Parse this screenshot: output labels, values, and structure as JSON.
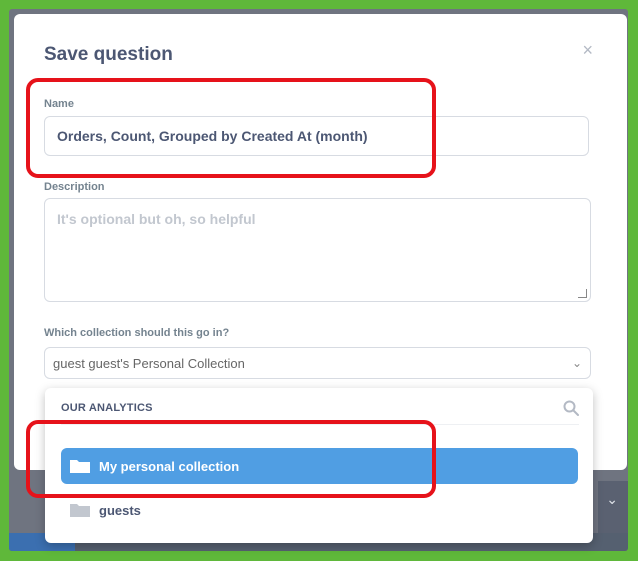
{
  "dialog": {
    "title": "Save question",
    "close_label": "×"
  },
  "name_field": {
    "label": "Name",
    "value": "Orders, Count, Grouped by Created At (month)"
  },
  "description_field": {
    "label": "Description",
    "placeholder": "It's optional but oh, so helpful"
  },
  "collection_field": {
    "label": "Which collection should this go in?",
    "selected_value": "guest guest's Personal Collection"
  },
  "collection_dropdown": {
    "header": "OUR ANALYTICS",
    "items": [
      {
        "label": "My personal collection",
        "selected": true
      },
      {
        "label": "guests",
        "selected": false
      }
    ]
  },
  "colors": {
    "accent": "#509ee3",
    "annotation": "#e6121a",
    "frame": "#5fb83a"
  }
}
